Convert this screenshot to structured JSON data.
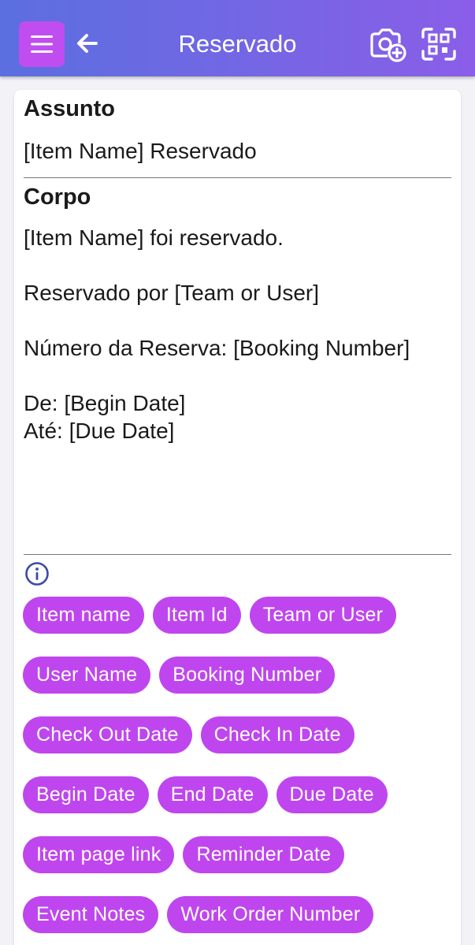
{
  "header": {
    "title": "Reservado",
    "menu_icon": "hamburger-menu-icon",
    "back_icon": "arrow-left-icon",
    "camera_icon": "camera-add-icon",
    "scan_icon": "qr-scan-icon"
  },
  "form": {
    "subject_label": "Assunto",
    "subject_value": "[Item Name] Reservado",
    "body_label": "Corpo",
    "body_value": "[Item Name] foi reservado.\n\nReservado por [Team or User]\n\nNúmero da Reserva: [Booking Number]\n\nDe: [Begin Date]\nAté: [Due Date]",
    "info_icon": "info-icon"
  },
  "chips": [
    "Item name",
    "Item Id",
    "Team or User",
    "User Name",
    "Booking Number",
    "Check Out Date",
    "Check In Date",
    "Begin Date",
    "End Date",
    "Due Date",
    "Item page link",
    "Reminder Date",
    "Event Notes",
    "Work Order Number"
  ],
  "colors": {
    "header_gradient_start": "#5b6fe0",
    "header_gradient_end": "#8a5ee8",
    "accent": "#bf46ee",
    "info_icon": "#3b4aa6"
  }
}
